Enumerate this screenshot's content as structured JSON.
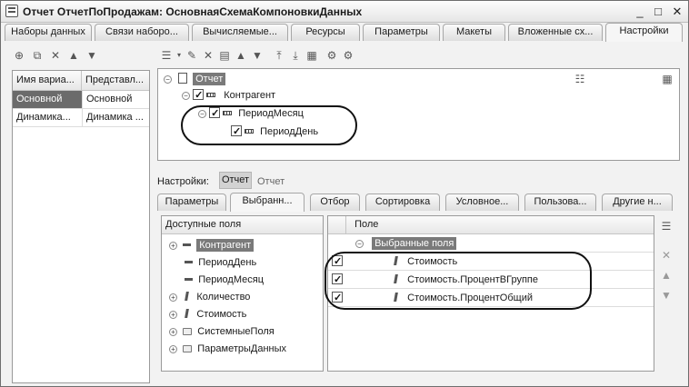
{
  "window": {
    "title": "Отчет ОтчетПоПродажам: ОсновнаяСхемаКомпоновкиДанных",
    "minimize": "_",
    "maximize": "□",
    "close": "✕"
  },
  "main_tabs": [
    "Наборы данных",
    "Связи наборо...",
    "Вычисляемые...",
    "Ресурсы",
    "Параметры",
    "Макеты",
    "Вложенные сх...",
    "Настройки"
  ],
  "variants": {
    "col1": "Имя вариа...",
    "col2": "Представл...",
    "rows": [
      [
        "Основной",
        "Основной"
      ],
      [
        "Динамика...",
        "Динамика ..."
      ]
    ]
  },
  "struct_tree": {
    "root": "Отчет",
    "n1": "Контрагент",
    "n2": "ПериодМесяц",
    "n3": "ПериодДень"
  },
  "settings_label": "Настройки:",
  "settings_btn": "Отчет",
  "settings_value": "Отчет",
  "inner_tabs": [
    "Параметры",
    "Выбранн...",
    "Отбор",
    "Сортировка",
    "Условное...",
    "Пользова...",
    "Другие н..."
  ],
  "available": {
    "header": "Доступные поля",
    "items": [
      "Контрагент",
      "ПериодДень",
      "ПериодМесяц",
      "Количество",
      "Стоимость",
      "СистемныеПоля",
      "ПараметрыДанных"
    ]
  },
  "selected": {
    "header": "Поле",
    "group": "Выбранные поля",
    "items": [
      "Стоимость",
      "Стоимость.ПроцентВГруппе",
      "Стоимость.ПроцентОбщий"
    ]
  }
}
